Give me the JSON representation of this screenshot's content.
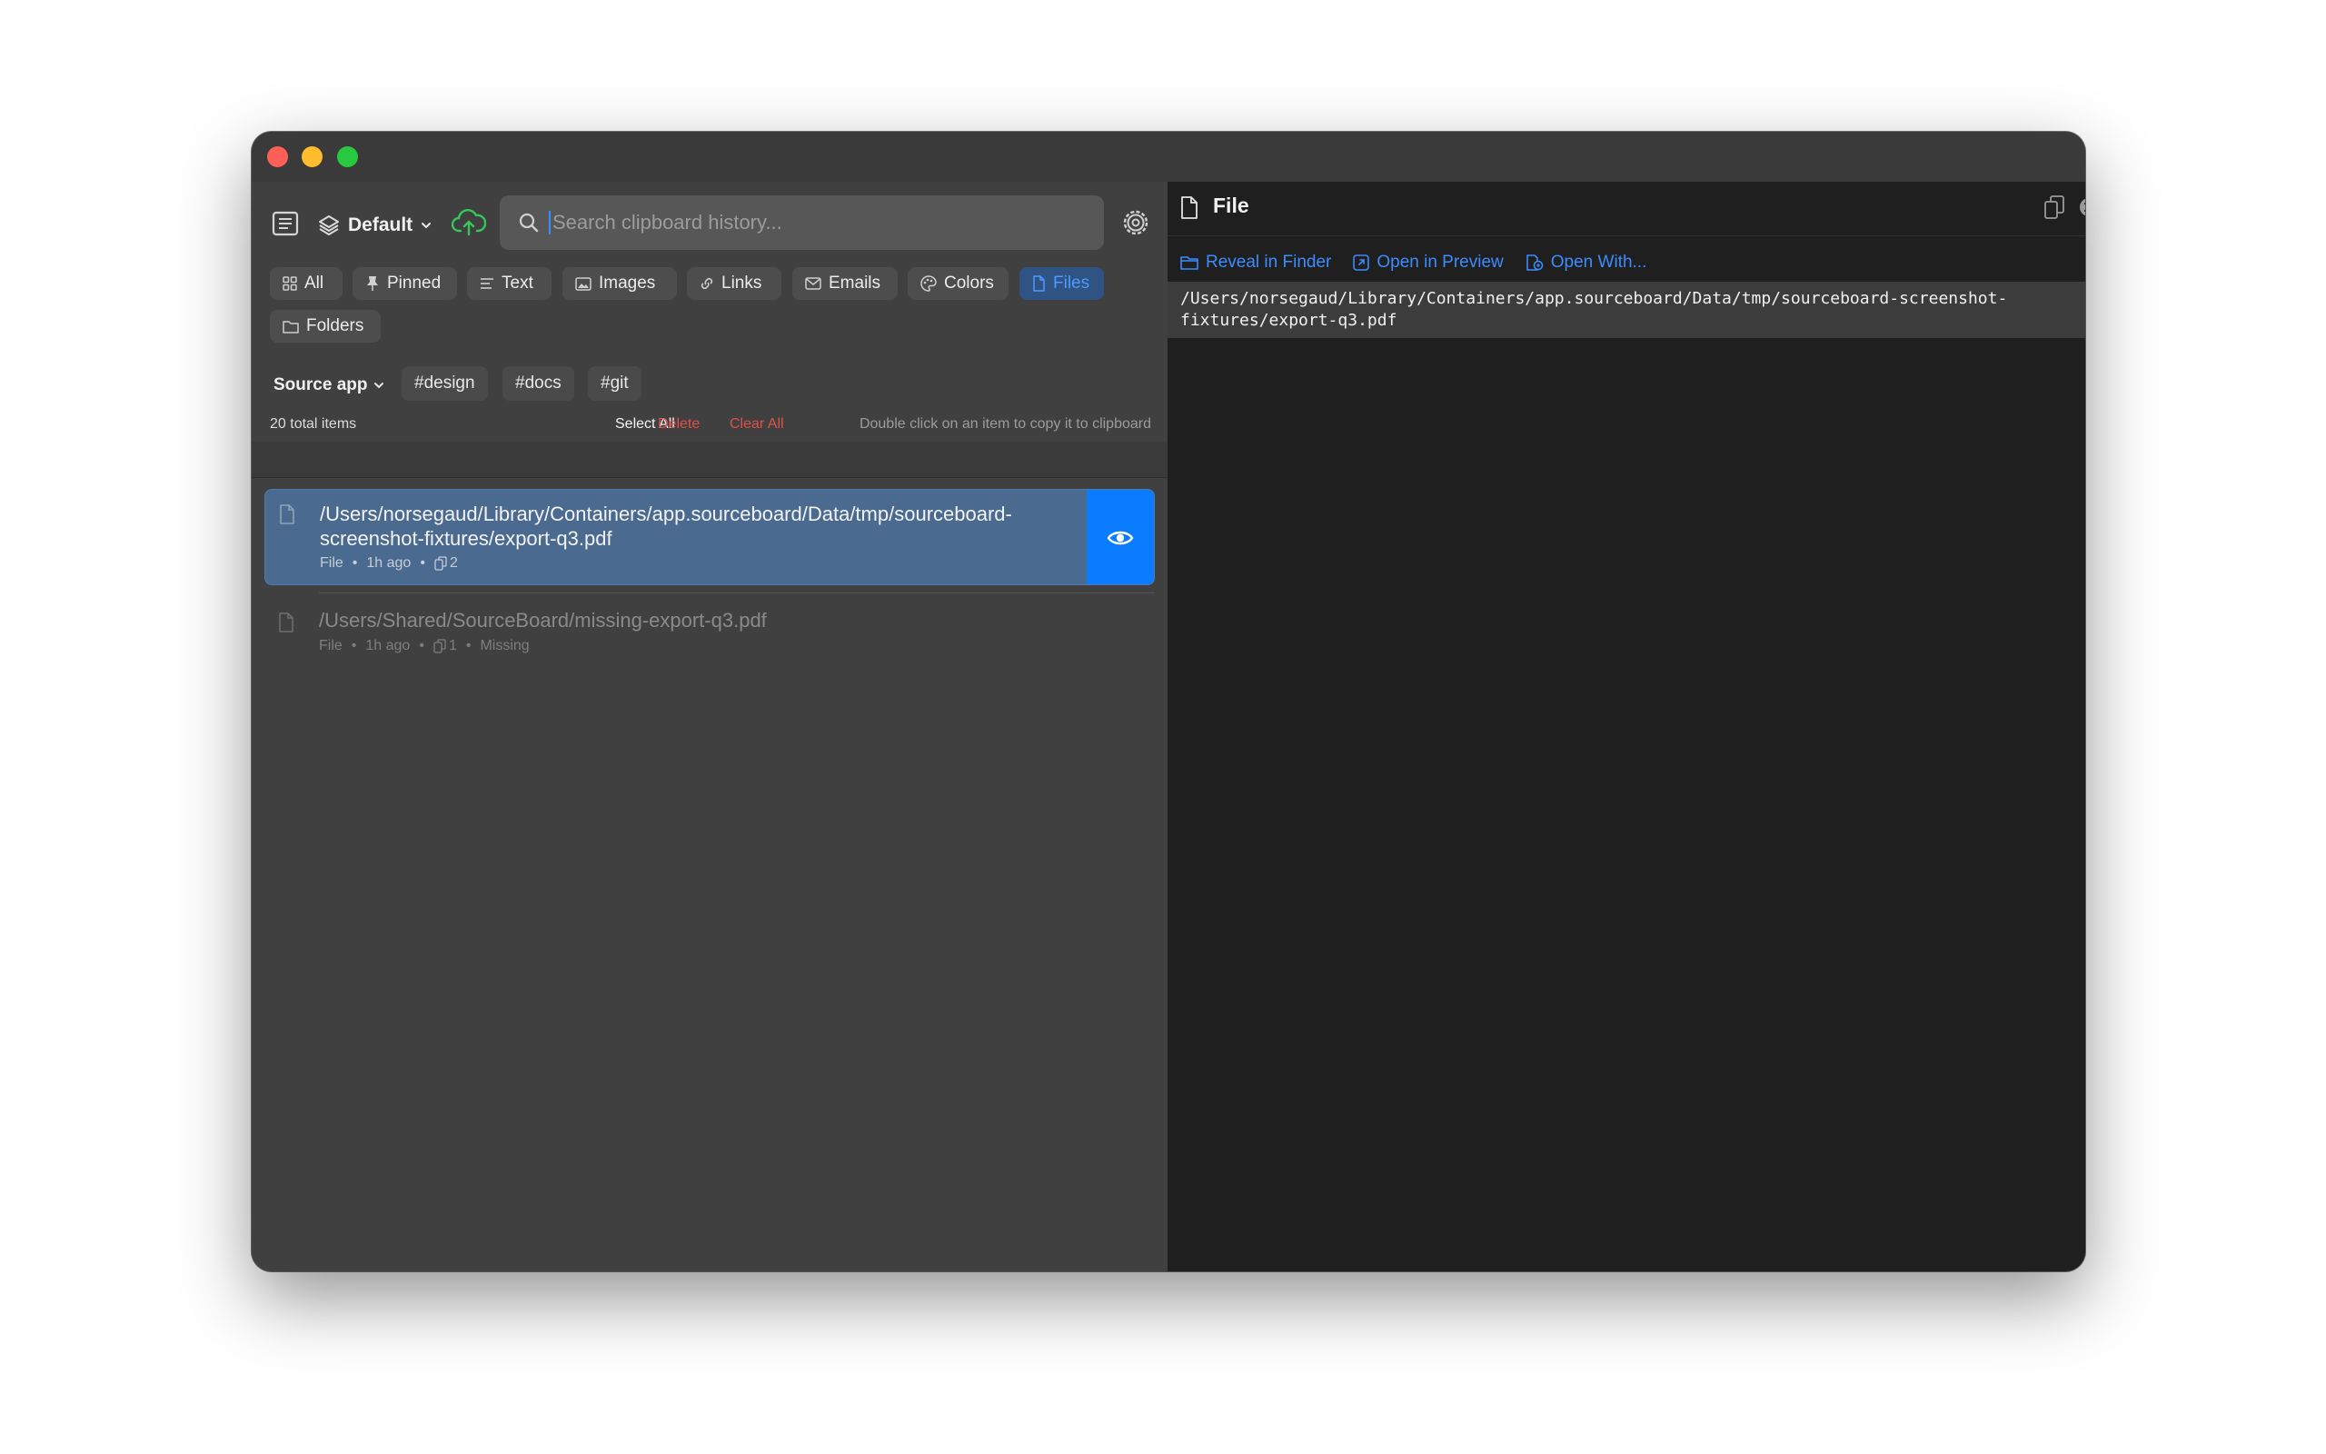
{
  "toolbar": {
    "profile_label": "Default",
    "search_placeholder": "Search clipboard history..."
  },
  "filters": [
    {
      "label": "All",
      "icon": "grid-icon",
      "active": false
    },
    {
      "label": "Pinned",
      "icon": "pin-icon",
      "active": false
    },
    {
      "label": "Text",
      "icon": "text-lines-icon",
      "active": false
    },
    {
      "label": "Images",
      "icon": "image-icon",
      "active": false
    },
    {
      "label": "Links",
      "icon": "link-icon",
      "active": false
    },
    {
      "label": "Emails",
      "icon": "envelope-icon",
      "active": false
    },
    {
      "label": "Colors",
      "icon": "palette-icon",
      "active": false
    },
    {
      "label": "Files",
      "icon": "document-icon",
      "active": true
    },
    {
      "label": "Folders",
      "icon": "folder-icon",
      "active": false
    }
  ],
  "source_app": {
    "label": "Source app"
  },
  "tags": [
    "#design",
    "#docs",
    "#git"
  ],
  "status": {
    "total": "20 total items",
    "select_all": "Select All",
    "delete": "Delete",
    "clear_all": "Clear All",
    "hint": "Double click on an item to copy it to clipboard"
  },
  "items": [
    {
      "path": "/Users/norsegaud/Library/Containers/app.sourceboard/Data/tmp/sourceboard-screenshot-fixtures/export-q3.pdf",
      "type": "File",
      "time": "1h ago",
      "count": "2",
      "selected": true
    },
    {
      "path": "/Users/Shared/SourceBoard/missing-export-q3.pdf",
      "type": "File",
      "time": "1h ago",
      "count": "1",
      "status": "Missing"
    }
  ],
  "detail": {
    "title": "File",
    "actions": [
      "Reveal in Finder",
      "Open in Preview",
      "Open With..."
    ],
    "path": "/Users/norsegaud/Library/Containers/app.sourceboard/Data/tmp/sourceboard-screenshot-fixtures/export-q3.pdf"
  },
  "colors": {
    "accent": "#0a7cff",
    "destructive": "#e0504a",
    "selection": "#4a6a8f",
    "sync": "#34c759"
  }
}
